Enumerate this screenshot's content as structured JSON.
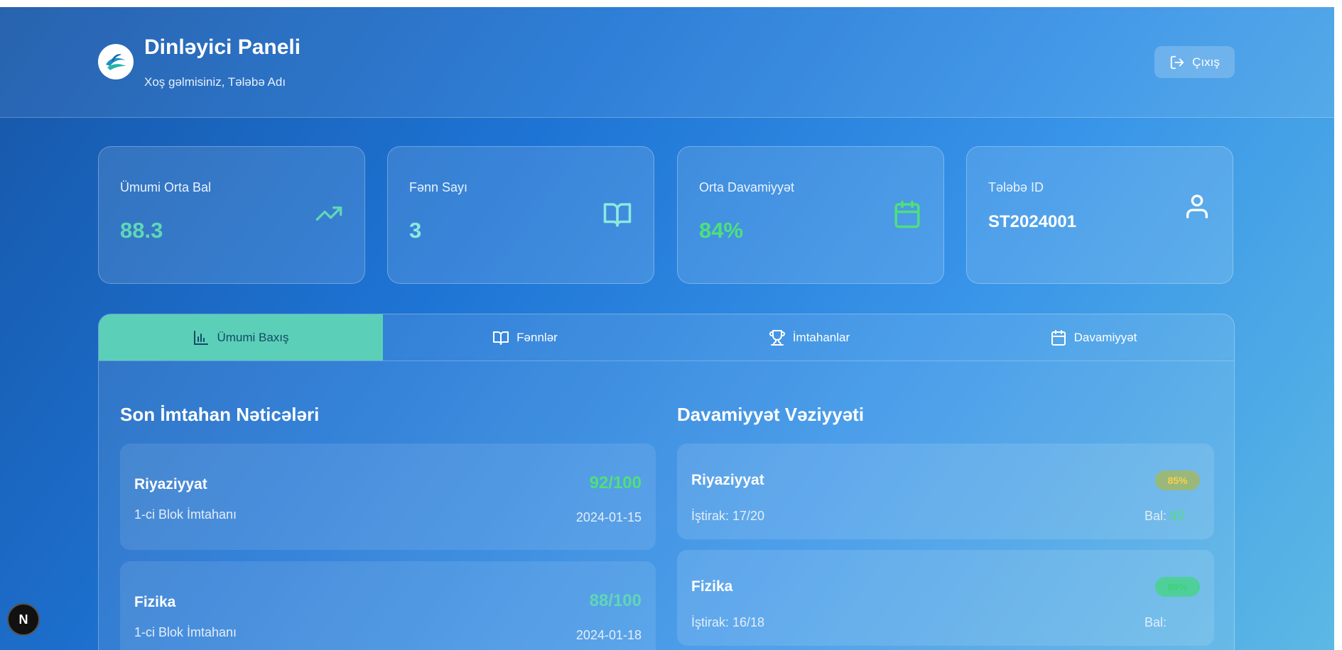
{
  "header": {
    "title": "Dinləyici Paneli",
    "subtitle": "Xoş gəlmisiniz, Tələbə Adı",
    "logout_label": "Çıxış"
  },
  "stats": [
    {
      "label": "Ümumi Orta Bal",
      "value": "88.3",
      "icon": "trending-up-icon",
      "color": "#5fd7b6"
    },
    {
      "label": "Fənn Sayı",
      "value": "3",
      "icon": "book-open-icon",
      "color": "#8fe8de"
    },
    {
      "label": "Orta Davamiyyət",
      "value": "84%",
      "icon": "calendar-icon",
      "color": "#4ee07a"
    },
    {
      "label": "Tələbə ID",
      "value": "ST2024001",
      "icon": "user-icon",
      "color": "#ffffff"
    }
  ],
  "tabs": [
    {
      "label": "Ümumi Baxış",
      "icon": "bar-chart-icon",
      "active": true
    },
    {
      "label": "Fənnlər",
      "icon": "book-open-icon",
      "active": false
    },
    {
      "label": "İmtahanlar",
      "icon": "trophy-icon",
      "active": false
    },
    {
      "label": "Davamiyyət",
      "icon": "calendar-icon",
      "active": false
    }
  ],
  "exams": {
    "title": "Son İmtahan Nəticələri",
    "items": [
      {
        "subject": "Riyaziyyat",
        "type": "1-ci Blok İmtahanı",
        "score": "92/100",
        "date": "2024-01-15",
        "score_color": "#4ee07a"
      },
      {
        "subject": "Fizika",
        "type": "1-ci Blok İmtahanı",
        "score": "88/100",
        "date": "2024-01-18",
        "score_color": "#5fd7b6"
      }
    ]
  },
  "attendance": {
    "title": "Davamiyyət Vəziyyəti",
    "items": [
      {
        "subject": "Riyaziyyat",
        "percent": "85%",
        "participation": "İştirak: 17/20",
        "bal_label": "Bal:",
        "bal_value": "92",
        "badge_bg": "#9ab87a",
        "badge_color": "#f6d24a",
        "bal_color": "#4ee07a"
      },
      {
        "subject": "Fizika",
        "percent": "89%",
        "participation": "İştirak: 16/18",
        "bal_label": "Bal:",
        "bal_value": "",
        "badge_bg": "#4fcf9a",
        "badge_color": "#3fd07a",
        "bal_color": "#4ee07a"
      }
    ]
  },
  "dev_indicator": {
    "label": "N"
  }
}
